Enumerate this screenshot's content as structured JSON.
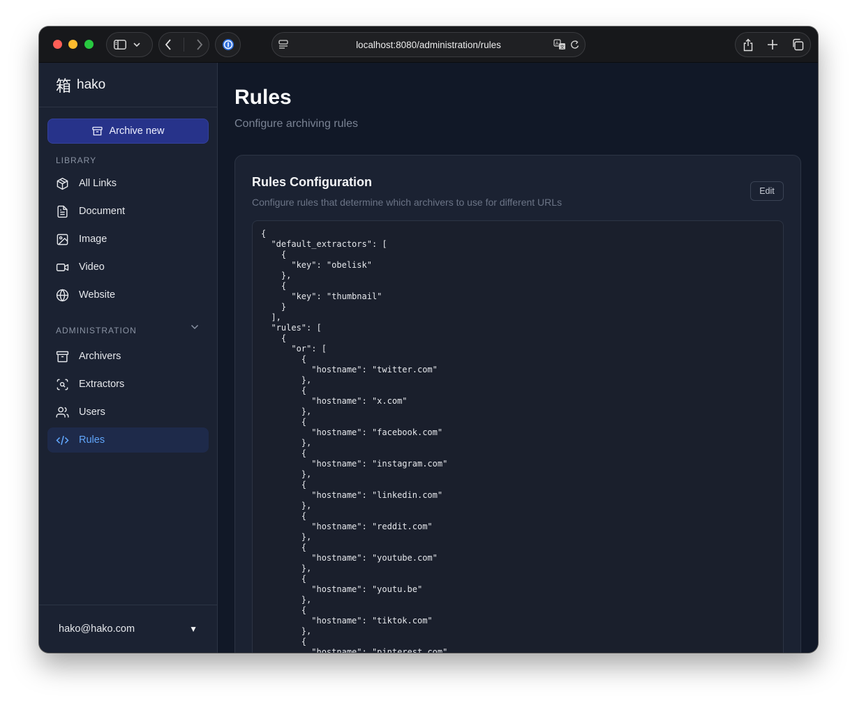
{
  "browser": {
    "url": "localhost:8080/administration/rules"
  },
  "sidebar": {
    "brand_kanji": "箱",
    "brand_name": "hako",
    "archive_button": "Archive new",
    "library_label": "LIBRARY",
    "library_items": [
      {
        "label": "All Links",
        "icon": "cube-icon"
      },
      {
        "label": "Document",
        "icon": "document-icon"
      },
      {
        "label": "Image",
        "icon": "image-icon"
      },
      {
        "label": "Video",
        "icon": "video-icon"
      },
      {
        "label": "Website",
        "icon": "globe-icon"
      }
    ],
    "admin_label": "ADMINISTRATION",
    "admin_items": [
      {
        "label": "Archivers",
        "icon": "archive-icon"
      },
      {
        "label": "Extractors",
        "icon": "scan-icon"
      },
      {
        "label": "Users",
        "icon": "users-icon"
      },
      {
        "label": "Rules",
        "icon": "code-icon",
        "active": true
      }
    ],
    "user_email": "hako@hako.com",
    "user_caret": "▼"
  },
  "main": {
    "title": "Rules",
    "subtitle": "Configure archiving rules",
    "card": {
      "title": "Rules Configuration",
      "description": "Configure rules that determine which archivers to use for different URLs",
      "edit_label": "Edit",
      "code": "{\n  \"default_extractors\": [\n    {\n      \"key\": \"obelisk\"\n    },\n    {\n      \"key\": \"thumbnail\"\n    }\n  ],\n  \"rules\": [\n    {\n      \"or\": [\n        {\n          \"hostname\": \"twitter.com\"\n        },\n        {\n          \"hostname\": \"x.com\"\n        },\n        {\n          \"hostname\": \"facebook.com\"\n        },\n        {\n          \"hostname\": \"instagram.com\"\n        },\n        {\n          \"hostname\": \"linkedin.com\"\n        },\n        {\n          \"hostname\": \"reddit.com\"\n        },\n        {\n          \"hostname\": \"youtube.com\"\n        },\n        {\n          \"hostname\": \"youtu.be\"\n        },\n        {\n          \"hostname\": \"tiktok.com\"\n        },\n        {\n          \"hostname\": \"pinterest.com\""
    }
  },
  "colors": {
    "accent": "#60a5fa",
    "primary_button": "#27338a",
    "background": "#111827",
    "sidebar": "#1b2232"
  }
}
